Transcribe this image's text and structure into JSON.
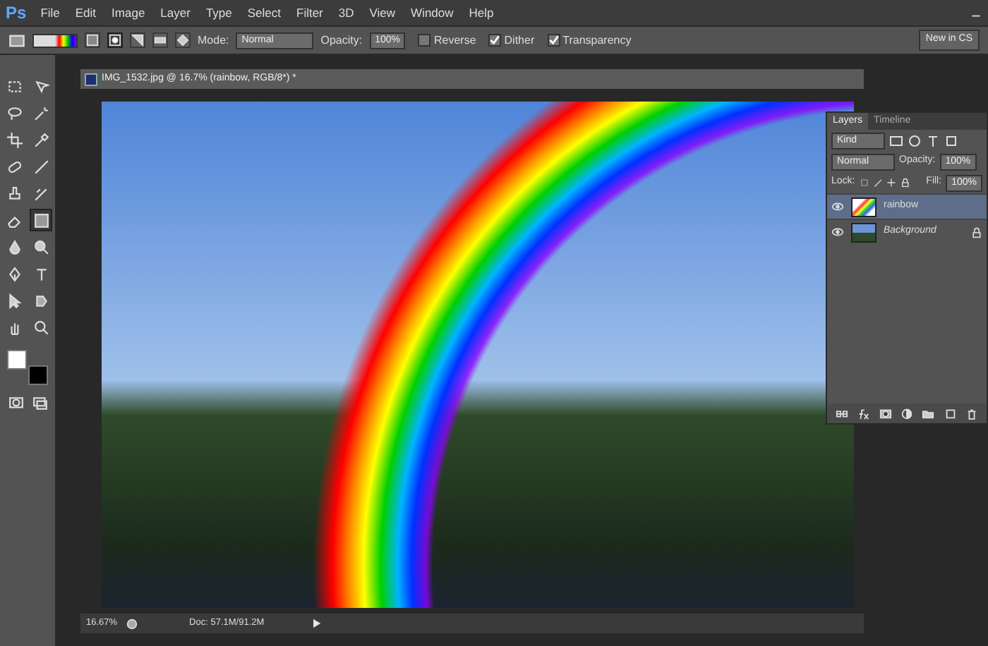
{
  "menu_bar": {
    "logo": "Ps",
    "items": [
      "File",
      "Edit",
      "Image",
      "Layer",
      "Type",
      "Select",
      "Filter",
      "3D",
      "View",
      "Window",
      "Help"
    ]
  },
  "options_bar": {
    "gradient_types": [
      {
        "selected": false
      },
      {
        "selected": true
      },
      {
        "selected": false
      },
      {
        "selected": false
      },
      {
        "selected": false
      }
    ],
    "mode_label": "Mode:",
    "mode": "Normal",
    "opacity_label": "Opacity:",
    "opacity": "100%",
    "checkboxes": [
      {
        "label": "Reverse",
        "checked": false
      },
      {
        "label": "Dither",
        "checked": true
      },
      {
        "label": "Transparency",
        "checked": true
      }
    ],
    "new_button": "New in CS"
  },
  "toolbox": {
    "tools": [
      {
        "selected": false
      },
      {
        "selected": false
      },
      {
        "selected": false
      },
      {
        "selected": false
      },
      {
        "selected": false
      },
      {
        "selected": false
      },
      {
        "selected": false
      },
      {
        "selected": false
      },
      {
        "selected": false
      },
      {
        "selected": false
      },
      {
        "selected": false
      },
      {
        "selected": true
      },
      {
        "selected": false
      },
      {
        "selected": false
      },
      {
        "selected": false
      },
      {
        "selected": false
      },
      {
        "selected": false
      },
      {
        "selected": false
      },
      {
        "selected": false
      },
      {
        "selected": false
      }
    ],
    "swatches": [
      {
        "color": "#ffffff"
      },
      {
        "color": "#000000"
      }
    ]
  },
  "document": {
    "title": "IMG_1532.jpg @ 16.7% (rainbow, RGB/8*) *",
    "zoom": "16.67%",
    "doc_info": "Doc: 57.1M/91.2M"
  },
  "layers_panel": {
    "tabs": [
      {
        "label": "Layers",
        "selected": true
      },
      {
        "label": "Timeline",
        "selected": false
      }
    ],
    "filter": "Kind",
    "blend_mode": "Normal",
    "opacity_label": "Opacity:",
    "opacity": "100%",
    "lock_label": "Lock:",
    "fill_label": "Fill:",
    "fill": "100%",
    "layers": [
      {
        "name": "rainbow",
        "kind": "normal",
        "selected": true,
        "visible": true
      },
      {
        "name": "Background",
        "kind": "background",
        "selected": false,
        "visible": true
      }
    ]
  }
}
